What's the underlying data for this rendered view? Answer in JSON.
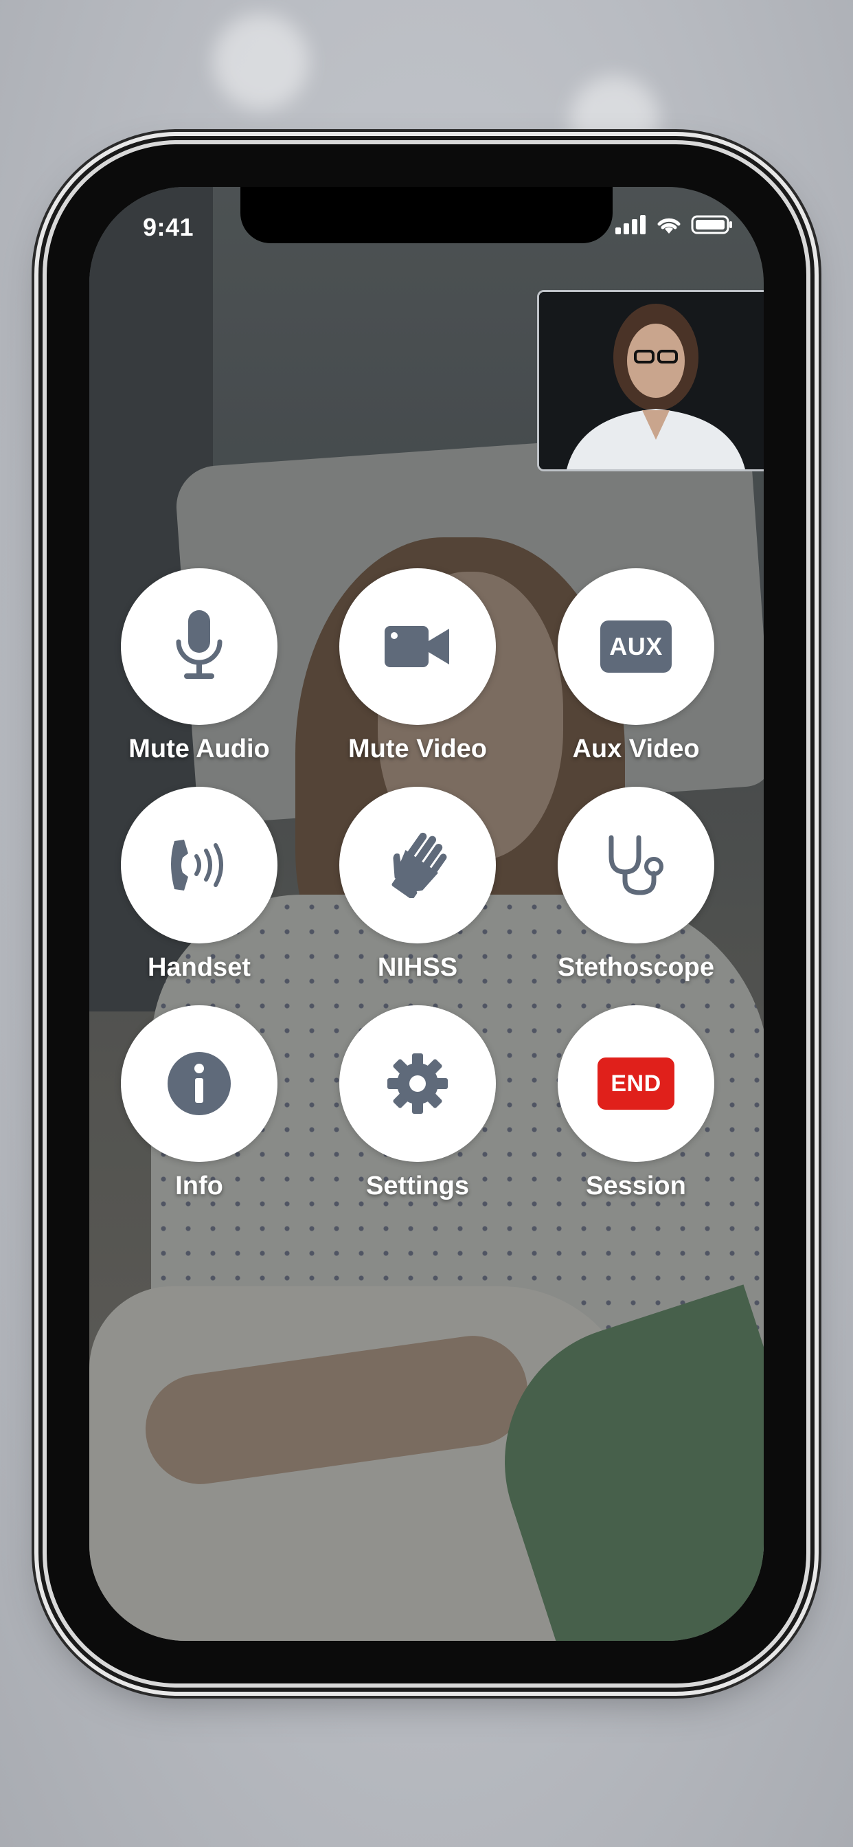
{
  "status_bar": {
    "time": "9:41"
  },
  "controls": [
    {
      "id": "mute-audio",
      "label": "Mute Audio",
      "icon": "microphone-icon"
    },
    {
      "id": "mute-video",
      "label": "Mute Video",
      "icon": "video-camera-icon"
    },
    {
      "id": "aux-video",
      "label": "Aux Video",
      "icon": "aux-icon",
      "icon_text": "AUX"
    },
    {
      "id": "handset",
      "label": "Handset",
      "icon": "handset-icon"
    },
    {
      "id": "nihss",
      "label": "NIHSS",
      "icon": "glove-hand-icon"
    },
    {
      "id": "stethoscope",
      "label": "Stethoscope",
      "icon": "stethoscope-icon"
    },
    {
      "id": "info",
      "label": "Info",
      "icon": "info-icon"
    },
    {
      "id": "settings",
      "label": "Settings",
      "icon": "gear-icon"
    },
    {
      "id": "end-session",
      "label": "Session",
      "icon": "end-icon",
      "icon_text": "END"
    }
  ],
  "colors": {
    "icon_gray": "#5f6a7a",
    "end_red": "#e0201b",
    "button_bg": "#ffffff"
  }
}
